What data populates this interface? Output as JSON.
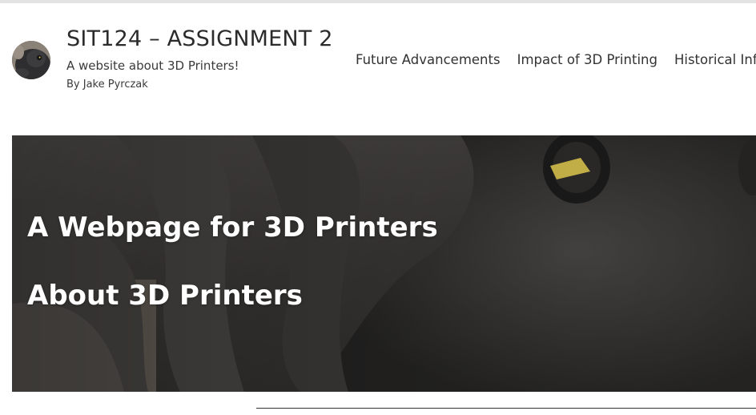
{
  "site": {
    "title": "SIT124 – ASSIGNMENT 2",
    "tagline": "A website about 3D Printers!",
    "byline": "By Jake Pyrczak",
    "logo_icon": "octopus-avatar-icon"
  },
  "nav": {
    "items": [
      {
        "label": "Future Advancements"
      },
      {
        "label": "Impact of 3D Printing"
      },
      {
        "label": "Historical Inf"
      }
    ]
  },
  "hero": {
    "heading_1": "A Webpage for 3D Printers",
    "heading_2": "About 3D Printers",
    "image_subject": "3D printed dark grey octopus close-up"
  },
  "colors": {
    "text": "#2b2b2b",
    "hero_text": "#ffffff",
    "hero_bg": "#3a3836"
  }
}
